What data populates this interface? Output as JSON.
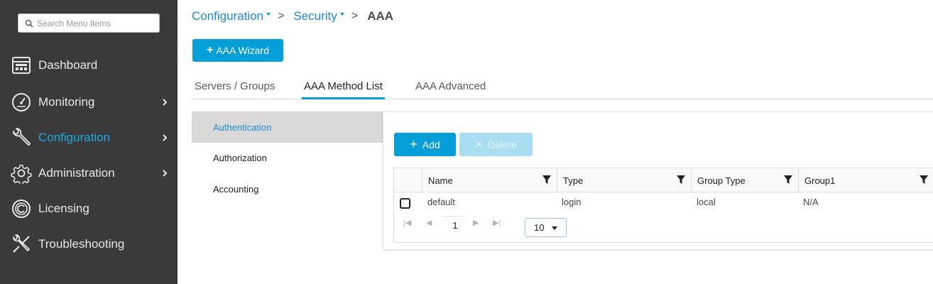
{
  "search": {
    "placeholder": "Search Menu Items"
  },
  "sidebar": {
    "items": [
      {
        "label": "Dashboard"
      },
      {
        "label": "Monitoring"
      },
      {
        "label": "Configuration"
      },
      {
        "label": "Administration"
      },
      {
        "label": "Licensing"
      },
      {
        "label": "Troubleshooting"
      }
    ]
  },
  "breadcrumb": {
    "level1": "Configuration",
    "level2": "Security",
    "current": "AAA"
  },
  "wizard_button": {
    "label": "AAA Wizard"
  },
  "tabs": [
    {
      "label": "Servers / Groups"
    },
    {
      "label": "AAA Method List"
    },
    {
      "label": "AAA Advanced"
    }
  ],
  "method_tabs": [
    {
      "label": "Authentication"
    },
    {
      "label": "Authorization"
    },
    {
      "label": "Accounting"
    }
  ],
  "toolbar": {
    "add_label": "Add",
    "delete_label": "Delete"
  },
  "table": {
    "columns": [
      "Name",
      "Type",
      "Group Type",
      "Group1"
    ],
    "rows": [
      {
        "name": "default",
        "type": "login",
        "group_type": "local",
        "group1": "N/A"
      }
    ]
  },
  "pagination": {
    "current_page": "1",
    "page_size": "10"
  },
  "colors": {
    "accent": "#049fd9",
    "sidebar_bg": "#3a3a3a",
    "active_link": "#1fa7e0"
  },
  "icons": {
    "search": "search-icon",
    "dashboard": "dashboard-icon",
    "monitoring": "gauge-icon",
    "configuration": "wrench-icon",
    "administration": "gear-icon",
    "licensing": "license-icon",
    "troubleshooting": "tools-icon",
    "filter": "filter-icon"
  }
}
